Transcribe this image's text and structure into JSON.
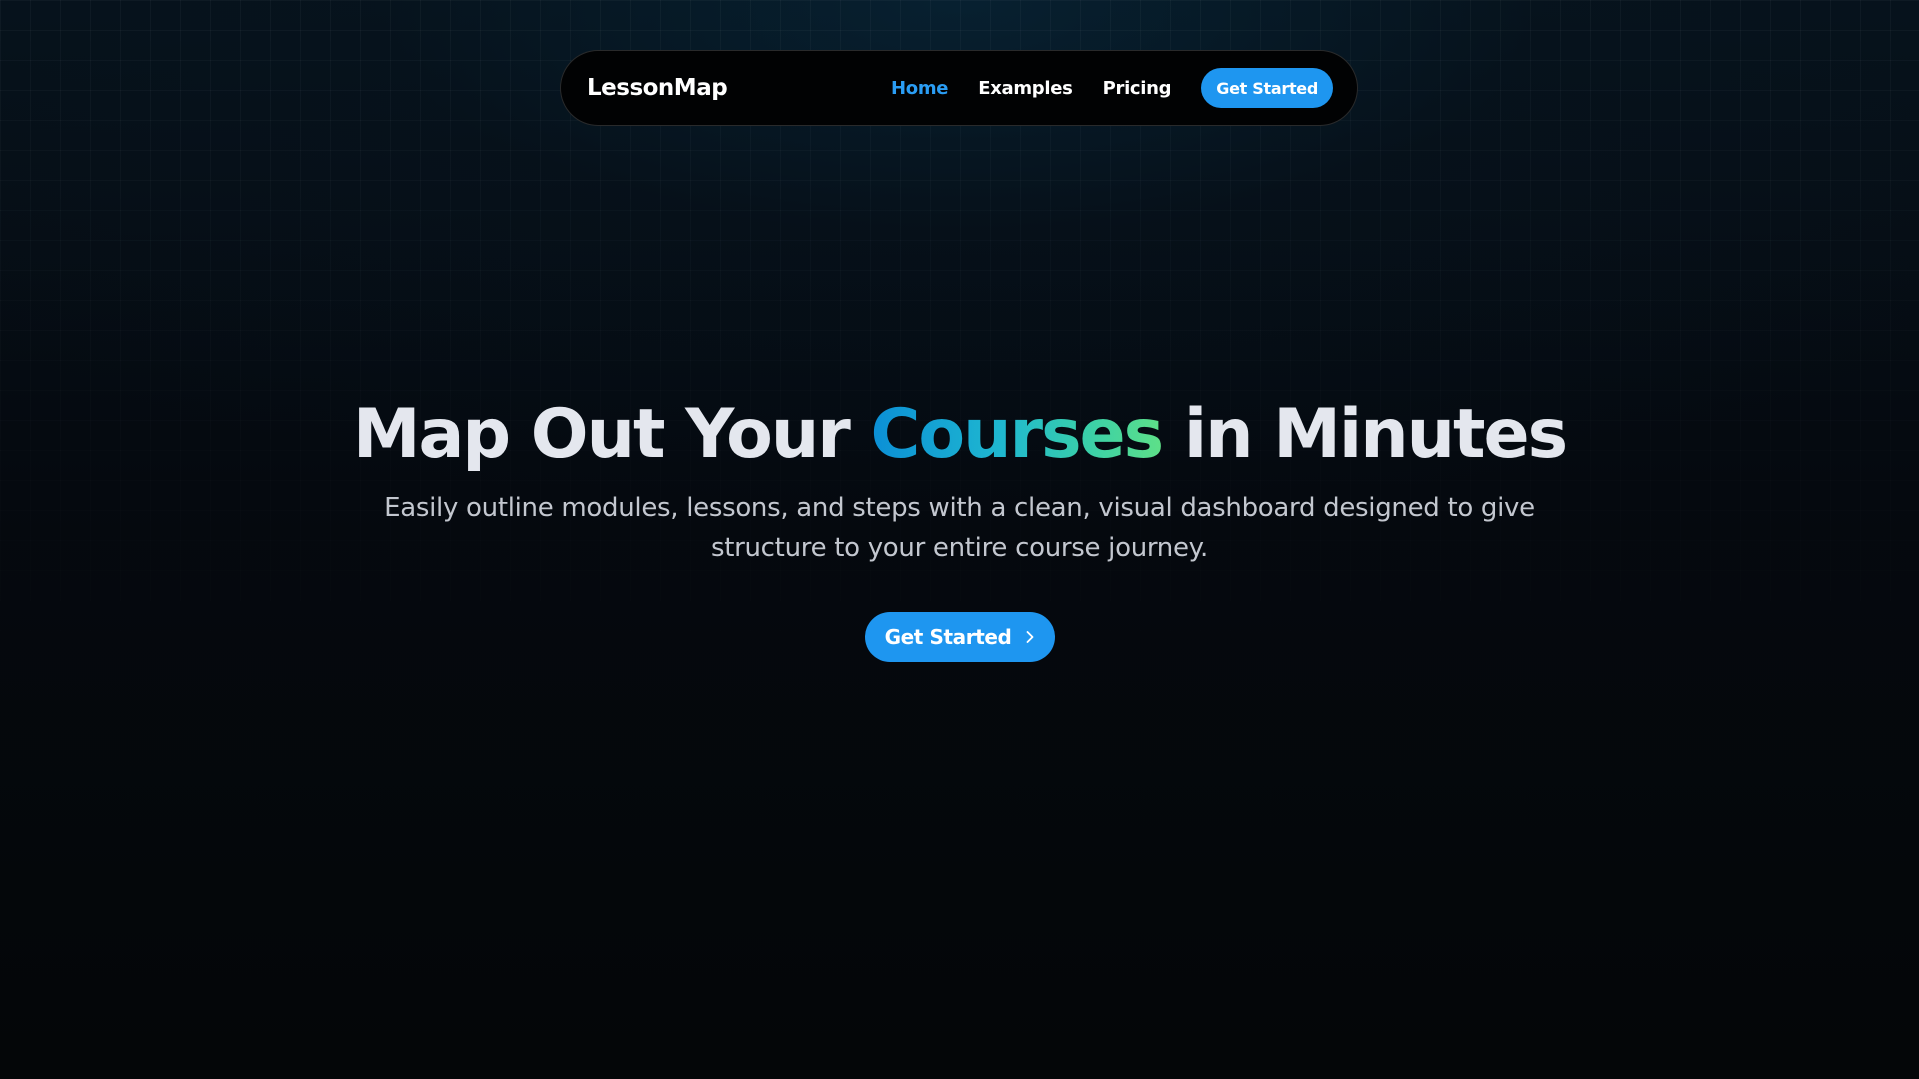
{
  "nav": {
    "brand": "LessonMap",
    "links": [
      {
        "label": "Home",
        "active": true
      },
      {
        "label": "Examples",
        "active": false
      },
      {
        "label": "Pricing",
        "active": false
      }
    ],
    "cta_label": "Get Started"
  },
  "hero": {
    "headline_before": "Map Out Your",
    "headline_accent": "Courses",
    "headline_after": "in Minutes",
    "subtitle": "Easily outline modules, lessons, and steps with a clean, visual dashboard designed to give structure to your entire course journey.",
    "cta_label": "Get Started",
    "cta_icon": "chevron-right-icon"
  },
  "colors": {
    "accent_blue": "#1e96f0",
    "active_link": "#2a9df4",
    "gradient_start": "#0b8fd6",
    "gradient_end": "#5ee088",
    "background": "#05070b"
  }
}
